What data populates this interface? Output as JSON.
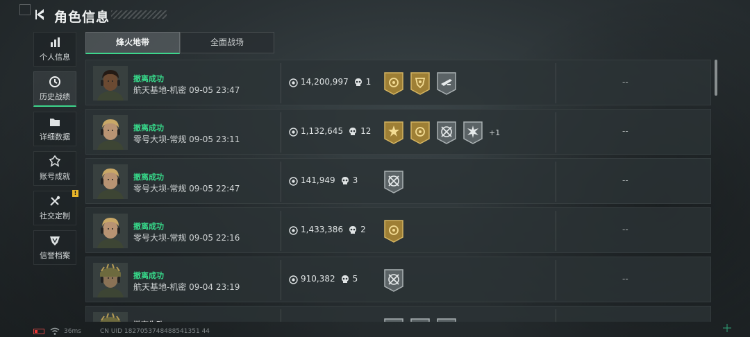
{
  "header": {
    "title": "角色信息"
  },
  "sidebar": {
    "items": [
      {
        "label": "个人信息",
        "icon": "bar-chart-icon"
      },
      {
        "label": "历史战绩",
        "icon": "clock-icon",
        "active": true
      },
      {
        "label": "详细数据",
        "icon": "folder-icon"
      },
      {
        "label": "账号成就",
        "icon": "emblem-icon"
      },
      {
        "label": "社交定制",
        "icon": "tools-icon",
        "badge": "!"
      },
      {
        "label": "信誉档案",
        "icon": "shield-icon"
      }
    ]
  },
  "tabs": [
    {
      "label": "烽火地带",
      "active": true
    },
    {
      "label": "全面战场",
      "active": false
    }
  ],
  "records": [
    {
      "status": "撤离成功",
      "map": "航天基地-机密",
      "time": "09-05 23:47",
      "value": "14,200,997",
      "kills": "1",
      "medals": [
        "gold-crosshair-medal",
        "gold-shield-medal",
        "grey-rifle-medal"
      ],
      "extra": "",
      "result": "--",
      "avatar": "dark-skin"
    },
    {
      "status": "撤离成功",
      "map": "零号大坝-常规",
      "time": "09-05 23:11",
      "value": "1,132,645",
      "kills": "12",
      "medals": [
        "gold-star-medal",
        "gold-crosshair-medal",
        "grey-reticle-medal",
        "grey-burst-medal"
      ],
      "extra": "+1",
      "result": "--",
      "avatar": "blond"
    },
    {
      "status": "撤离成功",
      "map": "零号大坝-常规",
      "time": "09-05 22:47",
      "value": "141,949",
      "kills": "3",
      "medals": [
        "grey-reticle-medal"
      ],
      "extra": "",
      "result": "--",
      "avatar": "blond"
    },
    {
      "status": "撤离成功",
      "map": "零号大坝-常规",
      "time": "09-05 22:16",
      "value": "1,433,386",
      "kills": "2",
      "medals": [
        "gold-crosshair-medal"
      ],
      "extra": "",
      "result": "--",
      "avatar": "blond"
    },
    {
      "status": "撤离成功",
      "map": "航天基地-机密",
      "time": "09-04 23:19",
      "value": "910,382",
      "kills": "5",
      "medals": [
        "grey-reticle-medal"
      ],
      "extra": "",
      "result": "--",
      "avatar": "helmet"
    },
    {
      "status": "撤离失败",
      "map": "",
      "time": "",
      "value": "",
      "kills": "",
      "medals": [
        "grey-partial-medal",
        "grey-partial-medal",
        "grey-partial-medal"
      ],
      "extra": "",
      "result": "",
      "avatar": "helmet"
    }
  ],
  "footer": {
    "ping": "36ms",
    "uid": "CN UID 1827053748488541351 44"
  },
  "colors": {
    "success": "#37d98a",
    "accent": "#3dd68c",
    "gold": "#b8953a",
    "badge": "#e8b62a"
  }
}
